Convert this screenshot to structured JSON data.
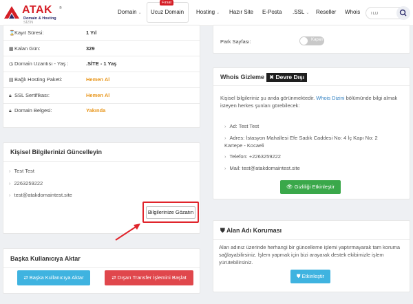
{
  "header": {
    "logo_brand": "ATAK",
    "logo_tagline": "Domain & Hosting",
    "logo_tagline_sub": "SİZİN",
    "logo_reg": "®",
    "nav": [
      {
        "label": "Domain",
        "has_chevron": true
      },
      {
        "label": "Ucuz Domain",
        "has_chevron": false
      },
      {
        "label": "Hosting",
        "has_chevron": true
      },
      {
        "label": "Hazır Site",
        "has_chevron": false
      },
      {
        "label": "E-Posta",
        "has_chevron": false
      },
      {
        "label": ".SSL",
        "has_chevron": true
      },
      {
        "label": "Reseller",
        "has_chevron": false
      },
      {
        "label": "Whois",
        "has_chevron": false
      }
    ],
    "firsat_badge": "Fırsat",
    "search_placeholder": "TLD",
    "search_icon": "search-icon"
  },
  "domain_info": {
    "rows": [
      {
        "icon": "hourglass-icon",
        "glyph": "⌛",
        "label": "Kayıt Süresi:",
        "value": "1 Yıl",
        "highlight": false
      },
      {
        "icon": "calendar-icon",
        "glyph": "📅",
        "label": "Kalan Gün:",
        "value": "329",
        "highlight": false
      },
      {
        "icon": "clock-icon",
        "glyph": "⏲",
        "label": "Domain Uzantısı - Yaş :",
        "value": ".SİTE - 1 Yaş",
        "highlight": false
      },
      {
        "icon": "server-icon",
        "glyph": "▤",
        "label": "Bağlı Hosting Paketi:",
        "value": "Hemen Al",
        "highlight": true
      },
      {
        "icon": "lock-icon",
        "glyph": "🔒",
        "label": "SSL Sertifikası:",
        "value": "Hemen Al",
        "highlight": true
      },
      {
        "icon": "lock-icon",
        "glyph": "🔒",
        "label": "Domain Belgesi:",
        "value": "Yakında",
        "highlight": true
      }
    ],
    "highlight_color": "#e8961b"
  },
  "park": {
    "label": "Park Sayfası:",
    "toggle_label": "Kapalı"
  },
  "whois": {
    "title": "Whois Gizleme",
    "status": "Devre Dışı",
    "intro_1": "Kişisel bilgileriniz şu anda görünmektedir.",
    "intro_link": "Whois Dizini",
    "intro_2": "bölümünde bilgi almak isteyen herkes şunları görebilecek:",
    "items": [
      "Ad: Test Test",
      "Adres: İstasyon Mahallesi Efe Sadık Caddesi No: 4 İç Kapı No: 2",
      "Kartepe - Kocaeli",
      "Telefon: +2263259222",
      "Mail: test@atakdomaintest.site"
    ],
    "button_label": "Gizliliği Etkinleştir",
    "button_color": "#3aa84a"
  },
  "personal": {
    "title": "Kişisel Bilgilerinizi Güncelleyin",
    "items": [
      "Test Test",
      "2263259222",
      "test@atakdomaintest.site"
    ],
    "button_label": "Bilgilerinize Gözatın",
    "highlight_color": "#e0242b"
  },
  "protection": {
    "title": "Alan Adı Koruması",
    "text": "Alan adınız üzerinde herhangi bir güncelleme işlemi yaptırmayarak tam koruma sağlayabilirsiniz. İşlem yapmak için bizi arayarak destek ekibimizle işlem yürütebilirsiniz.",
    "button_label": "Etkinleştir",
    "button_color": "#3fb3e0"
  },
  "transfer": {
    "title": "Başka Kullanıcıya Aktar",
    "button_user": "Başka Kullanıcıya Aktar",
    "button_user_color": "#3fb3e0",
    "button_external": "Dışarı Transfer İşlemini Başlat",
    "button_external_color": "#e0474c"
  }
}
